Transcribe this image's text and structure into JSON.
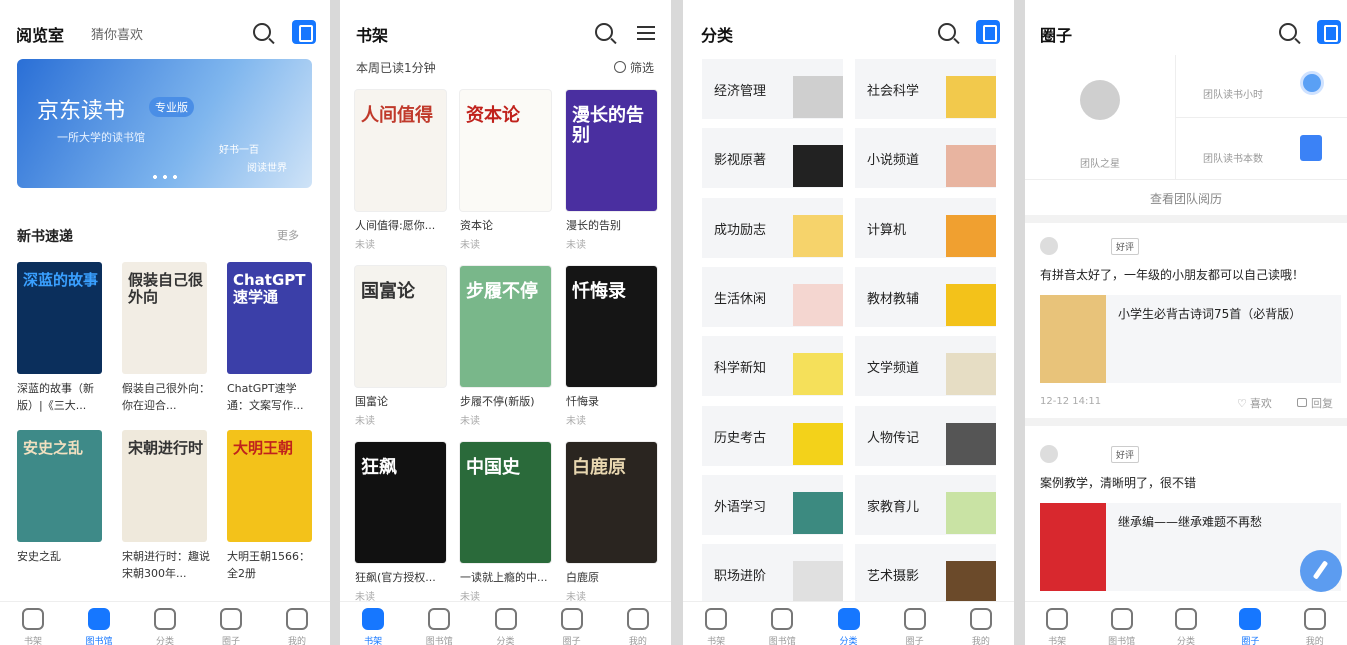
{
  "reading_room": {
    "title": "阅览室",
    "subtitle": "猜你喜欢",
    "banner_title": "京东读书",
    "banner_tag": "专业版",
    "banner_line": "一所大学的读书馆",
    "banner_side1": "好书一百",
    "banner_side2": "阅读世界",
    "section": "新书速递",
    "more": "更多",
    "books": [
      {
        "cover": "深蓝的故事",
        "title": "深蓝的故事（新版）|《三大...",
        "bg": "#0b2f5c",
        "fg": "#3aa0ff"
      },
      {
        "cover": "假装自己很外向",
        "title": "假装自己很外向：你在迎合...",
        "bg": "#f2ede4",
        "fg": "#333"
      },
      {
        "cover": "ChatGPT速学通",
        "title": "ChatGPT速学通：文案写作...",
        "bg": "#3b3fa8",
        "fg": "#fff"
      },
      {
        "cover": "安史之乱",
        "title": "安史之乱",
        "bg": "#3e8a88",
        "fg": "#f2e0c0"
      },
      {
        "cover": "宋朝进行时",
        "title": "宋朝进行时：趣说宋朝300年...",
        "bg": "#efe9dc",
        "fg": "#333"
      },
      {
        "cover": "大明王朝",
        "title": "大明王朝1566：全2册",
        "bg": "#f3c21a",
        "fg": "#c0221c"
      }
    ]
  },
  "bookshelf": {
    "title": "书架",
    "week": "本周已读1分钟",
    "filter": "筛选",
    "books": [
      {
        "cover": "人间值得",
        "title": "人间值得:愿你...",
        "status": "未读",
        "bg": "#f7f4ef",
        "fg": "#c0392b"
      },
      {
        "cover": "资本论",
        "title": "资本论",
        "status": "未读",
        "bg": "#fbfaf6",
        "fg": "#c0221c"
      },
      {
        "cover": "漫长的告别",
        "title": "漫长的告别",
        "status": "未读",
        "bg": "#4a2fa0",
        "fg": "#fff"
      },
      {
        "cover": "国富论",
        "title": "国富论",
        "status": "未读",
        "bg": "#f5f3ee",
        "fg": "#333"
      },
      {
        "cover": "步履不停",
        "title": "步履不停(新版)",
        "status": "未读",
        "bg": "#79b78a",
        "fg": "#fff"
      },
      {
        "cover": "忏悔录",
        "title": "忏悔录",
        "status": "未读",
        "bg": "#151515",
        "fg": "#fff"
      },
      {
        "cover": "狂飙",
        "title": "狂飙(官方授权...",
        "status": "未读",
        "bg": "#111",
        "fg": "#fff"
      },
      {
        "cover": "中国史",
        "title": "一读就上瘾的中...",
        "status": "未读",
        "bg": "#2a6a3a",
        "fg": "#fff"
      },
      {
        "cover": "白鹿原",
        "title": "白鹿原",
        "status": "未读",
        "bg": "#2a2520",
        "fg": "#e8d7b0"
      }
    ]
  },
  "categories": {
    "title": "分类",
    "items": [
      {
        "label": "经济管理",
        "color": "#cfcfcf"
      },
      {
        "label": "社会科学",
        "color": "#f2c94c"
      },
      {
        "label": "影视原著",
        "color": "#222"
      },
      {
        "label": "小说频道",
        "color": "#e8b4a0"
      },
      {
        "label": "成功励志",
        "color": "#f6d36b"
      },
      {
        "label": "计算机",
        "color": "#f0a030"
      },
      {
        "label": "生活休闲",
        "color": "#f4d6d0"
      },
      {
        "label": "教材教辅",
        "color": "#f3c21a"
      },
      {
        "label": "科学新知",
        "color": "#f5e05a"
      },
      {
        "label": "文学频道",
        "color": "#e6ddc4"
      },
      {
        "label": "历史考古",
        "color": "#f3d21a"
      },
      {
        "label": "人物传记",
        "color": "#555"
      },
      {
        "label": "外语学习",
        "color": "#3c8a80"
      },
      {
        "label": "家教育儿",
        "color": "#c9e3a4"
      },
      {
        "label": "职场进阶",
        "color": "#e0e0e0"
      },
      {
        "label": "艺术摄影",
        "color": "#6b4a2a"
      }
    ]
  },
  "circle": {
    "title": "圈子",
    "team_name": "团队之星",
    "hours_label": "团队读书小时",
    "books_label": "团队读书本数",
    "history": "查看团队阅历",
    "review_tag": "好评",
    "posts": [
      {
        "text": "有拼音太好了，一年级的小朋友都可以自己读哦！",
        "book": "小学生必背古诗词75首（必背版）",
        "time": "12-12 14:11",
        "like": "喜欢",
        "reply": "回复",
        "cover": "#e8c37a"
      },
      {
        "text": "案例教学，清晰明了，很不错",
        "book": "继承编——继承难题不再愁",
        "time": "",
        "like": "",
        "reply": "",
        "cover": "#d8282e"
      }
    ]
  },
  "nav": {
    "labels": [
      "书架",
      "图书馆",
      "分类",
      "圈子",
      "我的"
    ]
  }
}
